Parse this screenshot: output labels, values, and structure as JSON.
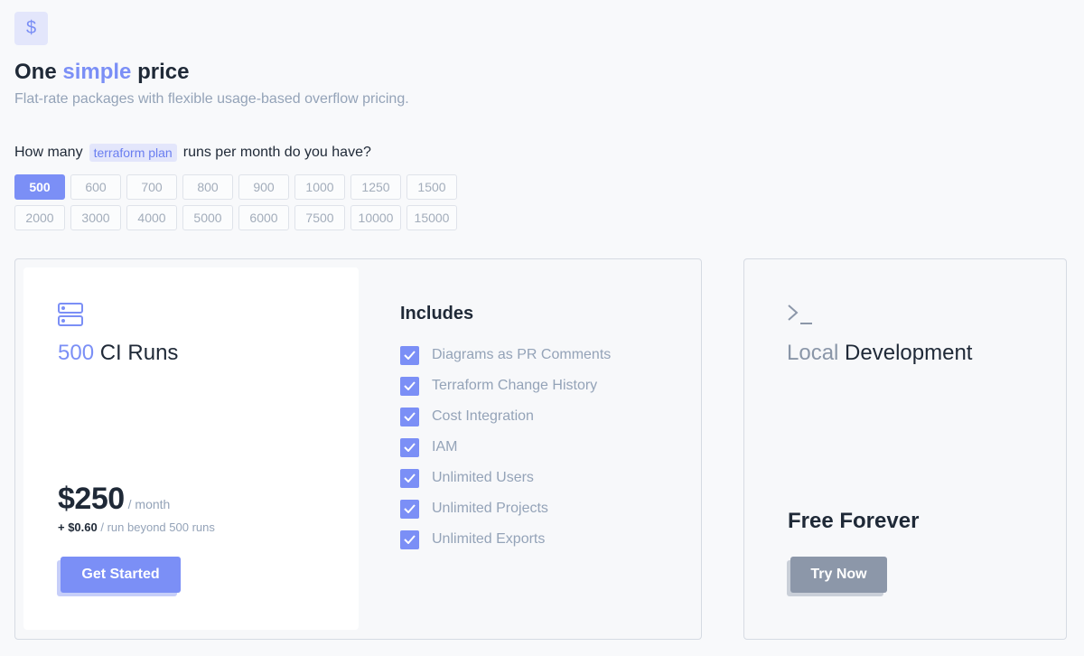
{
  "header": {
    "title_pre": "One",
    "title_accent": "simple",
    "title_post": "price",
    "subtitle": "Flat-rate packages with flexible usage-based overflow pricing.",
    "icon": "dollar-icon",
    "icon_glyph": "$"
  },
  "question": {
    "pre": "How many",
    "code": "terraform plan",
    "post": "runs per month do you have?"
  },
  "run_options": [
    "500",
    "600",
    "700",
    "800",
    "900",
    "1000",
    "1250",
    "1500",
    "2000",
    "3000",
    "4000",
    "5000",
    "6000",
    "7500",
    "10000",
    "15000"
  ],
  "selected_run_option": "500",
  "plan": {
    "runs": "500",
    "runs_label": "CI Runs",
    "price": "$250",
    "per": "/ month",
    "overage_price": "+ $0.60",
    "overage_text": "/ run beyond 500 runs",
    "cta": "Get Started",
    "icon": "server-icon",
    "includes_title": "Includes",
    "features": [
      "Diagrams as PR Comments",
      "Terraform Change History",
      "Cost Integration",
      "IAM",
      "Unlimited Users",
      "Unlimited Projects",
      "Unlimited Exports"
    ]
  },
  "local": {
    "icon": "terminal-icon",
    "title_accent": "Local",
    "title_rest": "Development",
    "price": "Free Forever",
    "cta": "Try Now"
  },
  "colors": {
    "accent": "#7b8ff6",
    "muted": "#94a3b8",
    "gray_button": "#8c97a9",
    "background": "#f8f9fb"
  }
}
